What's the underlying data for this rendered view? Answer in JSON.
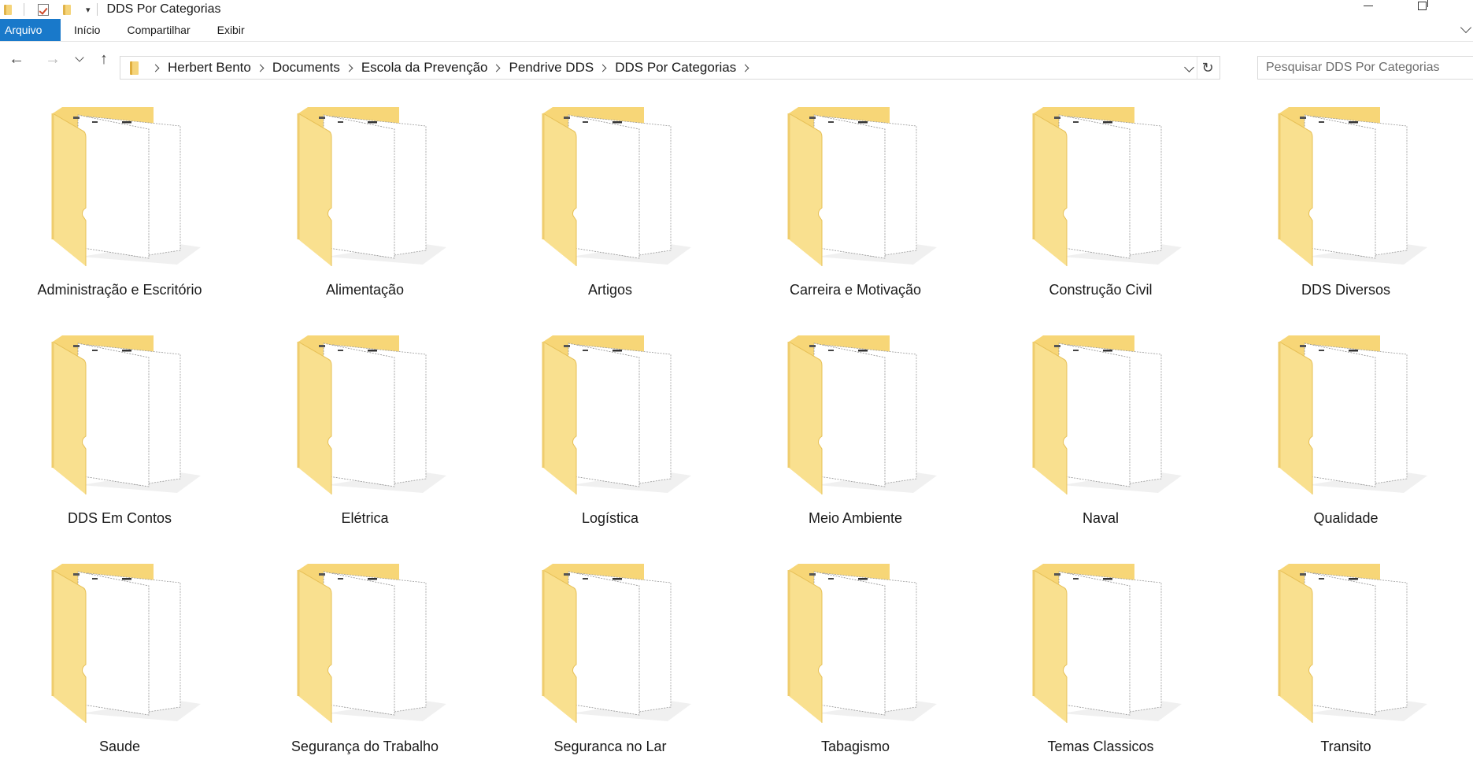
{
  "window": {
    "title": "DDS Por Categorias"
  },
  "ribbon": {
    "tabs": [
      "Arquivo",
      "Início",
      "Compartilhar",
      "Exibir"
    ]
  },
  "address_bar": {
    "crumbs": [
      "Herbert Bento",
      "Documents",
      "Escola da Prevenção",
      "Pendrive DDS",
      "DDS Por Categorias"
    ]
  },
  "search": {
    "placeholder": "Pesquisar DDS Por Categorias"
  },
  "folders": [
    "Administração e Escritório",
    "Alimentação",
    "Artigos",
    "Carreira e Motivação",
    "Construção Civil",
    "DDS Diversos",
    "DDS Em Contos",
    "Elétrica",
    "Logística",
    "Meio Ambiente",
    "Naval",
    "Qualidade",
    "Saude",
    "Segurança do Trabalho",
    "Seguranca no Lar",
    "Tabagismo",
    "Temas Classicos",
    "Transito"
  ],
  "colors": {
    "file_tab": "#1979ca",
    "folder_back": "#f7d677",
    "folder_front": "#f9e08f",
    "folder_shade": "#e8c25a"
  }
}
